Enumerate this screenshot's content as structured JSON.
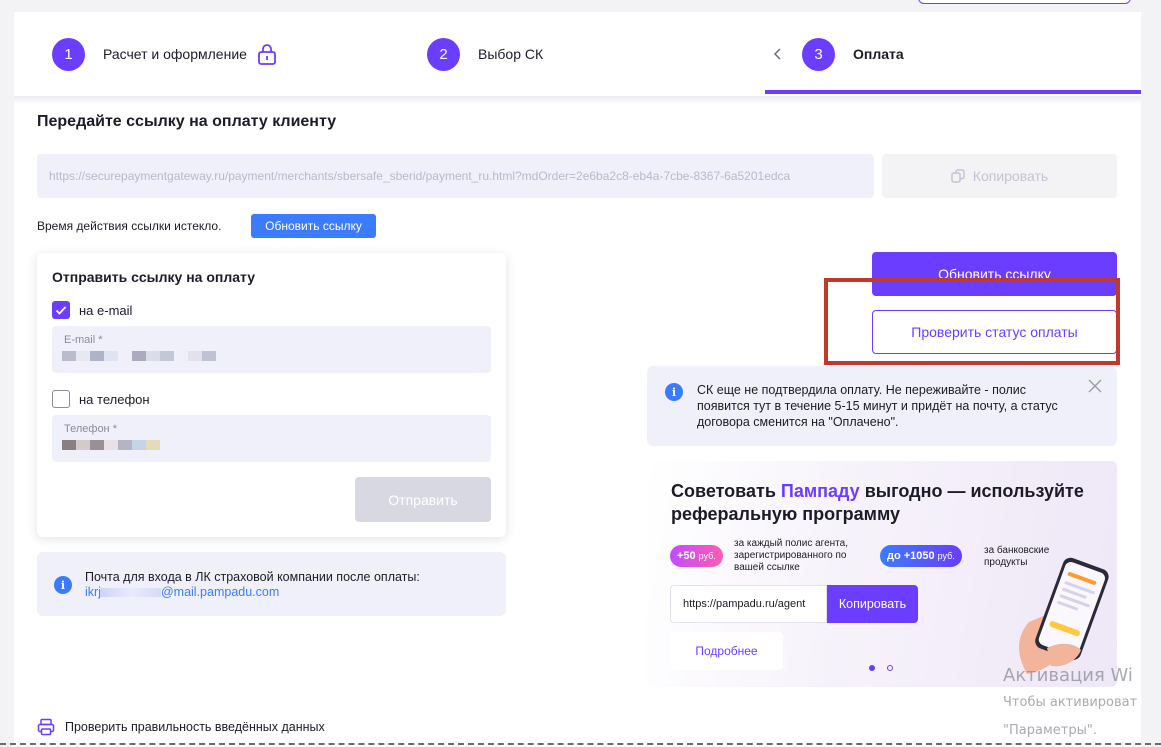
{
  "stepper": {
    "steps": [
      {
        "num": "1",
        "label": "Расчет и оформление"
      },
      {
        "num": "2",
        "label": "Выбор СК"
      },
      {
        "num": "3",
        "label": "Оплата"
      }
    ]
  },
  "payment": {
    "title": "Передайте ссылку на оплату клиенту",
    "link": "https://securepaymentgateway.ru/payment/merchants/sbersafe_sberid/payment_ru.html?mdOrder=2e6ba2c8-eb4a-7cbe-8367-6a5201edca",
    "copy_label": "Копировать",
    "expired_text": "Время действия ссылки истекло.",
    "refresh_small_label": "Обновить ссылку"
  },
  "send_form": {
    "title": "Отправить ссылку на оплату",
    "email_checkbox_label": "на e-mail",
    "email_field_label": "E-mail *",
    "phone_checkbox_label": "на телефон",
    "phone_field_label": "Телефон *",
    "send_label": "Отправить"
  },
  "mail_info": {
    "text": "Почта для входа в ЛК страховой компании после оплаты:",
    "address_prefix": "ikrj",
    "address_suffix": "@mail.pampadu.com"
  },
  "actions": {
    "refresh_label": "Обновить ссылку",
    "check_status_label": "Проверить статус оплаты"
  },
  "sk_notice": {
    "text": "СК еще не подтвердила оплату. Не переживайте - полис появится тут в течение 5-15 минут и придёт на почту, а статус договора сменится на \"Оплачено\"."
  },
  "promo": {
    "title_before": "Советовать ",
    "title_brand": "Пампаду",
    "title_after": " выгодно — используйте реферальную программу",
    "pill1_amount": "+50",
    "pill1_unit": "руб.",
    "pill1_note": "за каждый полис агента, зарегистрированного по вашей ссылке",
    "pill2_amount": "до +1050",
    "pill2_unit": "руб.",
    "pill2_note": "за банковские продукты",
    "ref_link": "https://pampadu.ru/agent",
    "copy_label": "Копировать",
    "more_label": "Подробнее",
    "brand_color": "#6a3dff"
  },
  "footer": {
    "verify_label": "Проверить правильность введённых данных"
  },
  "watermark": {
    "line1": "Активация Wi",
    "line2": "Чтобы активироват",
    "line3": "\"Параметры\"."
  }
}
